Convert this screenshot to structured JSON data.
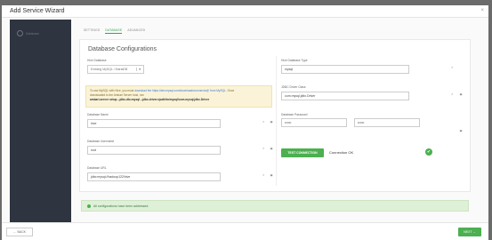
{
  "modal": {
    "title": "Add Service Wizard",
    "close_symbol": "×"
  },
  "sidebar": {
    "items": [
      {
        "label": "Database"
      }
    ]
  },
  "tabs": [
    {
      "label": "SETTINGS"
    },
    {
      "label": "DATABASE"
    },
    {
      "label": "ADVANCED"
    }
  ],
  "card": {
    "title": "Database Configurations"
  },
  "left": {
    "hive_database_label": "Hive Database",
    "hive_database_value": "Existing MySQL / MariaDB",
    "notice_line1_pre": "To use MySQL with Hive, you must ",
    "notice_link": "download the https://dev.mysql.com/downloads/connector/j/ from MySQL",
    "notice_line1_post": ". Once",
    "notice_line2": "downloaded to the Ambari Server host, run:",
    "notice_cmd": "ambari-server setup --jdbc-db=mysql --jdbc-driver=/path/to/mysql/com.mysql.jdbc.Driver",
    "db_name_label": "Database Name",
    "db_name_value": "hive",
    "db_username_label": "Database Username",
    "db_username_value": "root",
    "db_url_label": "Database URL",
    "db_url_value": "jdbc:mysql://hadoop122/hive"
  },
  "right": {
    "db_type_label": "Hive Database Type",
    "db_type_value": "mysql",
    "jdbc_class_label": "JDBC Driver Class",
    "jdbc_class_value": "com.mysql.jdbc.Driver",
    "password_label": "Database Password",
    "password_value": "••••••",
    "password_confirm_value": "••••••",
    "test_button_label": "TEST CONNECTION",
    "connection_status": "Connection OK",
    "ok_symbol": "✔"
  },
  "success": {
    "message": "All configurations have been addressed."
  },
  "footer": {
    "back_label": "← BACK",
    "next_label": "NEXT →"
  },
  "colors": {
    "accent": "#4caf50",
    "sidebar": "#2e3440",
    "notice_bg": "#fbf3d7",
    "success_bg": "#dff0d8"
  }
}
